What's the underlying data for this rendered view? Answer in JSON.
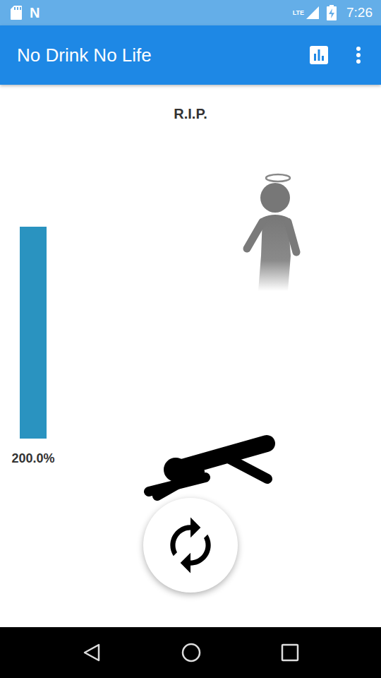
{
  "status_bar": {
    "notification_icons": [
      "N"
    ],
    "network": "LTE",
    "time": "7:26"
  },
  "app_bar": {
    "title": "No Drink No Life"
  },
  "status": "R.I.P.",
  "meter": {
    "level": 1,
    "reading": "200.0%"
  }
}
